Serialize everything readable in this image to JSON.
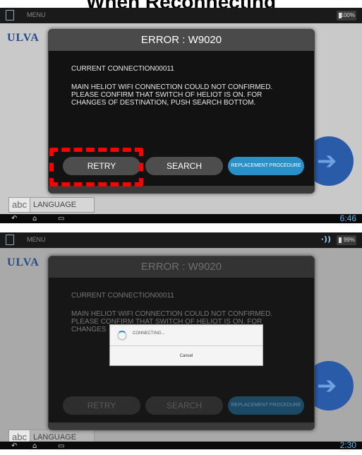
{
  "slide_title": "When Reconnecting",
  "screens": [
    {
      "status": {
        "menu": "MENU",
        "battery": "100%"
      },
      "logo": "ULVA",
      "dialog": {
        "title": "ERROR : W9020",
        "current_connection": "CURRENT CONNECTION00011",
        "message": "MAIN HELIOT WIFI CONNECTION COULD NOT CONFIRMED. PLEASE CONFIRM THAT SWITCH OF HELIOT IS ON. FOR CHANGES OF DESTINATION, PUSH SEARCH BOTTOM.",
        "buttons": {
          "retry": "RETRY",
          "search": "SEARCH",
          "replacement": "REPLACEMENT PROCEDURE"
        }
      },
      "language": {
        "abc": "abc",
        "label": "LANGUAGE"
      },
      "nav": {
        "clock": "6:46"
      }
    },
    {
      "status": {
        "menu": "MENU",
        "battery": "99%"
      },
      "logo": "ULVA",
      "dialog": {
        "title": "ERROR : W9020",
        "current_connection": "CURRENT CONNECTION00011",
        "message": "MAIN HELIOT WIFI CONNECTION COULD NOT CONFIRMED. PLEASE CONFIRM THAT SWITCH OF HELIOT IS ON. FOR CHANGES",
        "buttons": {
          "retry": "RETRY",
          "search": "SEARCH",
          "replacement": "REPLACEMENT PROCEDURE"
        }
      },
      "progress": {
        "text": "CONNECTING...",
        "cancel": "Cancel"
      },
      "language": {
        "abc": "abc",
        "label": "LANGUAGE"
      },
      "nav": {
        "clock": "2:30"
      }
    }
  ],
  "colors": {
    "highlight": "#ff0000",
    "accent_button": "#2b8fc8",
    "logo": "#234a8c"
  }
}
